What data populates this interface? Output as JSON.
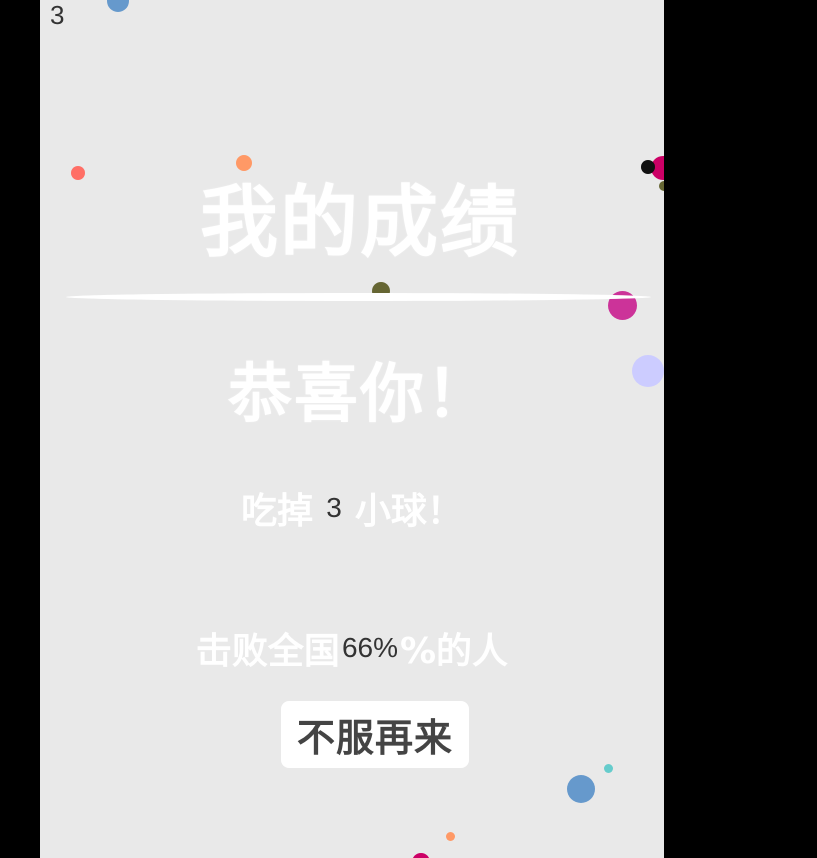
{
  "hud": {
    "score": "3"
  },
  "result": {
    "title": "我的成绩",
    "congrats": "恭喜你！",
    "eat_prefix": "吃掉",
    "eat_count": "3",
    "eat_suffix": "小球！",
    "beat_prefix": "击败全国",
    "beat_percent": "66%",
    "beat_suffix": "%的人",
    "retry_label": "不服再来"
  },
  "colors": {
    "background": "#e9e9e9",
    "side_panels": "#000000",
    "text_white": "#ffffff",
    "numbers": "#333333",
    "balls": [
      "#6699cc",
      "#ff6f66",
      "#ff9966",
      "#666633",
      "#cc3399",
      "#ccccff",
      "#cc0066",
      "#66cccc"
    ]
  }
}
